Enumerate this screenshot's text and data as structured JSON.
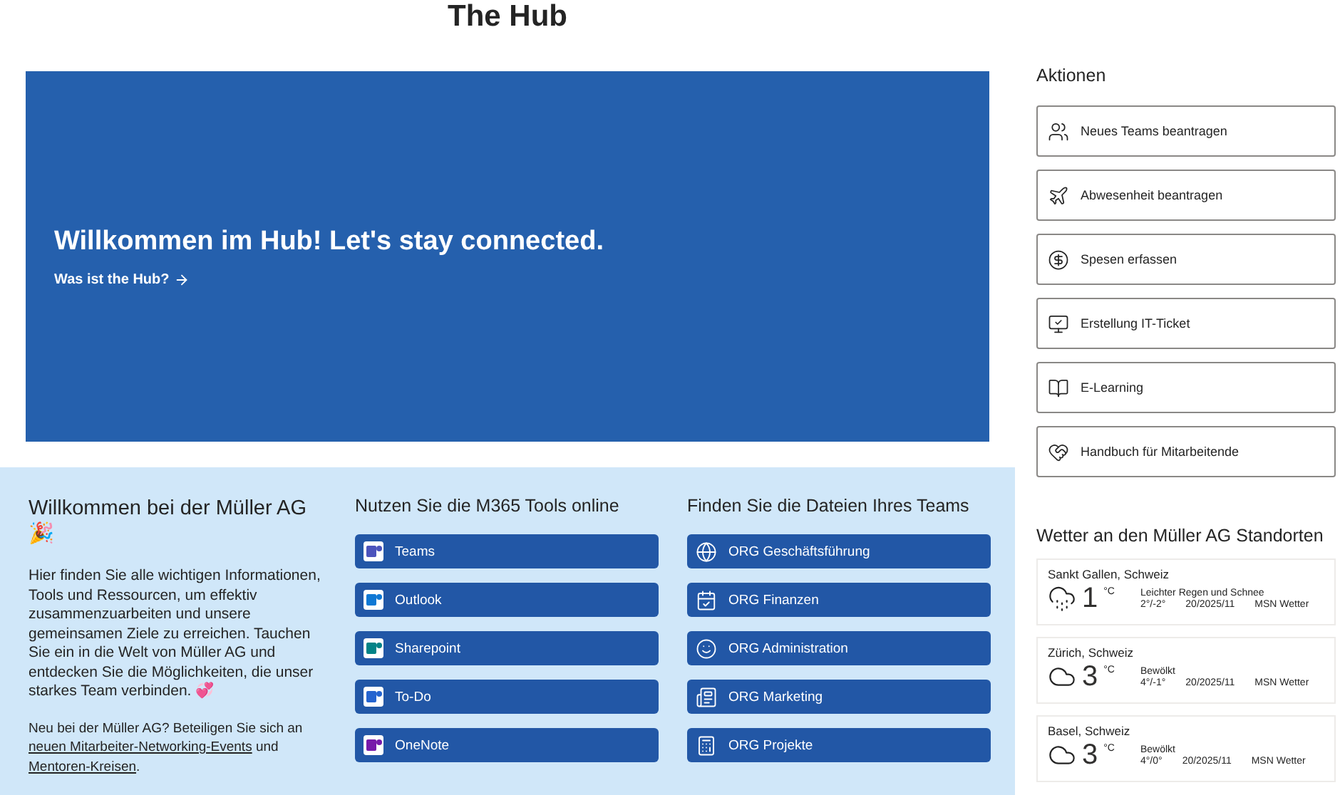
{
  "page_title": "The Hub",
  "hero": {
    "heading": "Willkommen im Hub! Let's stay connected.",
    "link": "Was ist the Hub?"
  },
  "welcome": {
    "heading": "Willkommen bei der Müller AG 🎉",
    "body": "Hier finden Sie alle wichtigen Informationen, Tools und Ressourcen, um effektiv zusammenzuarbeiten und unsere gemeinsamen Ziele zu erreichen. Tauchen Sie ein in die Welt von Müller AG und entdecken Sie die Möglichkeiten, die unser starkes Team verbinden. 💞",
    "note": [
      {
        "kind": "text",
        "text": "Neu bei der Müller AG? Beteiligen Sie sich an "
      },
      {
        "kind": "link",
        "text": "neuen Mitarbeiter-Networking-Events"
      },
      {
        "kind": "text",
        "text": " und "
      },
      {
        "kind": "link",
        "text": "Mentoren-Kreisen"
      },
      {
        "kind": "text",
        "text": "."
      }
    ]
  },
  "tools": {
    "heading": "Nutzen Sie die M365 Tools online",
    "items": [
      {
        "label": "Teams",
        "color": "#4b53bc"
      },
      {
        "label": "Outlook",
        "color": "#0f78d4"
      },
      {
        "label": "Sharepoint",
        "color": "#038387"
      },
      {
        "label": "To-Do",
        "color": "#2564cf"
      },
      {
        "label": "OneNote",
        "color": "#7719aa"
      }
    ]
  },
  "files": {
    "heading": "Finden Sie die Dateien Ihres Teams",
    "items": [
      "ORG Geschäftsführung",
      "ORG Finanzen",
      "ORG Administration",
      "ORG Marketing",
      "ORG Projekte"
    ]
  },
  "actions": {
    "heading": "Aktionen",
    "items": [
      "Neues Teams beantragen",
      "Abwesenheit beantragen",
      "Spesen erfassen",
      "Erstellung IT-Ticket",
      "E-Learning",
      "Handbuch für Mitarbeitende"
    ]
  },
  "weather": {
    "heading": "Wetter an den Müller AG Standorten",
    "items": [
      {
        "location": "Sankt Gallen, Schweiz",
        "kind": "rain",
        "temp": "1",
        "unit": "°C",
        "condition": "Leichter Regen und Schnee",
        "range": "2°/-2°",
        "date": "20/2025/11",
        "source": "MSN Wetter"
      },
      {
        "location": "Zürich, Schweiz",
        "kind": "cloud",
        "temp": "3",
        "unit": "°C",
        "condition": "Bewölkt",
        "range": "4°/-1°",
        "date": "20/2025/11",
        "source": "MSN Wetter"
      },
      {
        "location": "Basel, Schweiz",
        "kind": "cloud",
        "temp": "3",
        "unit": "°C",
        "condition": "Bewölkt",
        "range": "4°/0°",
        "date": "20/2025/11",
        "source": "MSN Wetter"
      }
    ]
  }
}
